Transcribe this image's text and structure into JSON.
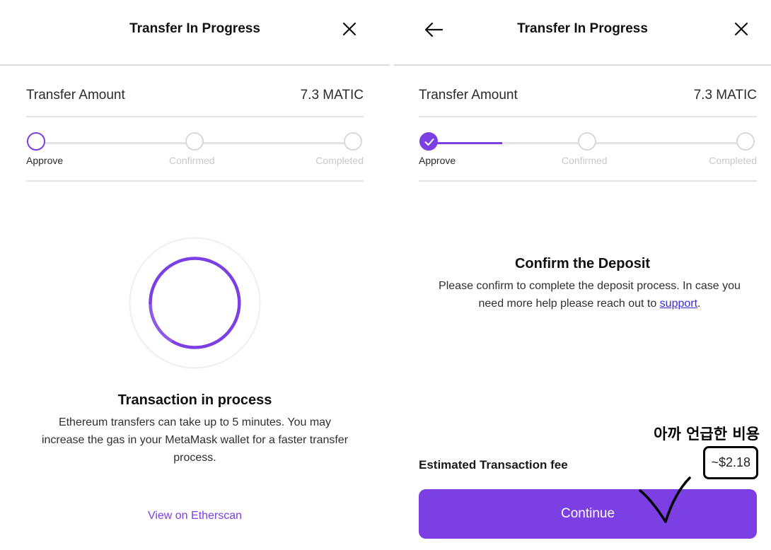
{
  "left": {
    "header": {
      "title": "Transfer In Progress"
    },
    "amount": {
      "label": "Transfer Amount",
      "value": "7.3 MATIC"
    },
    "steps": [
      "Approve",
      "Confirmed",
      "Completed"
    ],
    "status": {
      "title": "Transaction in process",
      "body_line1": "Ethereum transfers can take up to 5 minutes. You may",
      "body_line2": "increase the gas in your MetaMask wallet for a faster transfer",
      "body_line3": "process."
    },
    "etherscan_link": "View on Etherscan"
  },
  "right": {
    "header": {
      "title": "Transfer In Progress"
    },
    "amount": {
      "label": "Transfer Amount",
      "value": "7.3 MATIC"
    },
    "steps": [
      "Approve",
      "Confirmed",
      "Completed"
    ],
    "confirm": {
      "title": "Confirm the Deposit",
      "body_line1": "Please confirm to complete the deposit process. In case you",
      "body_line2_prefix": "need more help please reach out to ",
      "support_link": "support",
      "body_line2_suffix": "."
    },
    "fee": {
      "label": "Estimated Transaction fee",
      "value": "~$2.18"
    },
    "annotation": "아까 언급한 비용",
    "continue_label": "Continue"
  },
  "colors": {
    "accent": "#7b3fe4",
    "link": "#3a2fd8",
    "divider": "#d9d9de"
  }
}
